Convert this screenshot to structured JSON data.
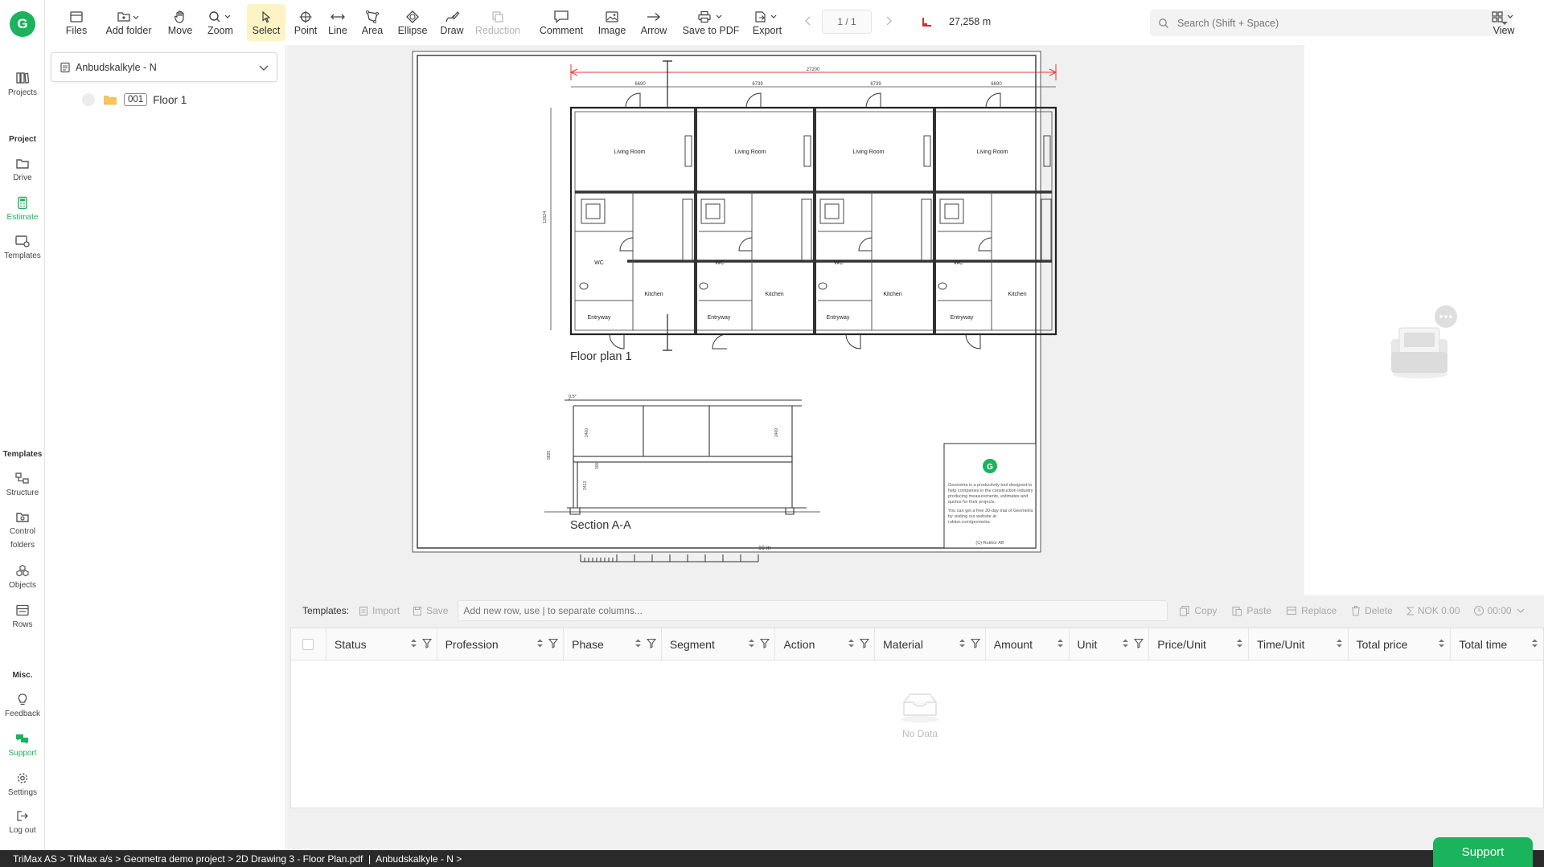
{
  "rail": {
    "logo": "G",
    "projects": "Projects",
    "project_heading": "Project",
    "drive": "Drive",
    "estimate": "Estimate",
    "templates": "Templates",
    "templates_heading": "Templates",
    "structure": "Structure",
    "control_folders_1": "Control",
    "control_folders_2": "folders",
    "objects": "Objects",
    "rows": "Rows",
    "misc_heading": "Misc.",
    "feedback": "Feedback",
    "support": "Support",
    "settings": "Settings",
    "logout": "Log out"
  },
  "toolbar": {
    "files": "Files",
    "add_folder": "Add folder",
    "move": "Move",
    "zoom": "Zoom",
    "select": "Select",
    "point": "Point",
    "line": "Line",
    "area": "Area",
    "ellipse": "Ellipse",
    "draw": "Draw",
    "reduction": "Reduction",
    "comment": "Comment",
    "image": "Image",
    "arrow": "Arrow",
    "save_pdf": "Save to PDF",
    "export": "Export",
    "page": "1 / 1",
    "measurement": "27,258 m",
    "search_placeholder": "Search (Shift + Space)",
    "view": "View"
  },
  "panel": {
    "estimate_select": "Anbudskalkyle - N",
    "tree": [
      {
        "code": "001",
        "label": "Floor 1"
      }
    ]
  },
  "drawing": {
    "dim_total": "27200",
    "dim_1": "6690",
    "dim_2": "6739",
    "dim_3": "6739",
    "dim_4": "6690",
    "dim_height": "12624",
    "rooms": {
      "living": "Living Room",
      "wc": "WC",
      "kitchen": "Kitchen",
      "entry": "Entryway"
    },
    "floor_plan_title": "Floor plan 1",
    "section_title": "Section A-A",
    "section_dim": "0.5°",
    "section_dims": [
      "9825",
      "2400",
      "2400",
      "300",
      "2413"
    ],
    "scale_label": "10 m",
    "titleblock_logo": "G",
    "titleblock_text_1": "Geometra is a productivity tool designed to help companies in the construction industry producing measurements, estimates and quotes for their projects.",
    "titleblock_text_2": "You can get a free 30-day trial of Geometra by visiting our website at rukkor.com/geometra",
    "titleblock_copy": "(C) Rukkor AB"
  },
  "templates_bar": {
    "label": "Templates:",
    "import": "Import",
    "save": "Save",
    "new_row_placeholder": "Add new row, use | to separate columns...",
    "copy": "Copy",
    "paste": "Paste",
    "replace": "Replace",
    "delete": "Delete",
    "nok": "NOK 0.00",
    "time": "00:00"
  },
  "table": {
    "columns": [
      "Status",
      "Profession",
      "Phase",
      "Segment",
      "Action",
      "Material",
      "Amount",
      "Unit",
      "Price/Unit",
      "Time/Unit",
      "Total price",
      "Total time"
    ],
    "empty": "No Data"
  },
  "status_bar": {
    "breadcrumb": "TriMax AS > TriMax a/s > Geometra demo project > 2D Drawing 3 - Floor Plan.pdf  |  Anbudskalkyle - N >"
  },
  "support_button": "Support",
  "colors": {
    "brand": "#1bb35c",
    "selected_tool": "#fdf3c4",
    "dimension_red": "#e53935"
  }
}
